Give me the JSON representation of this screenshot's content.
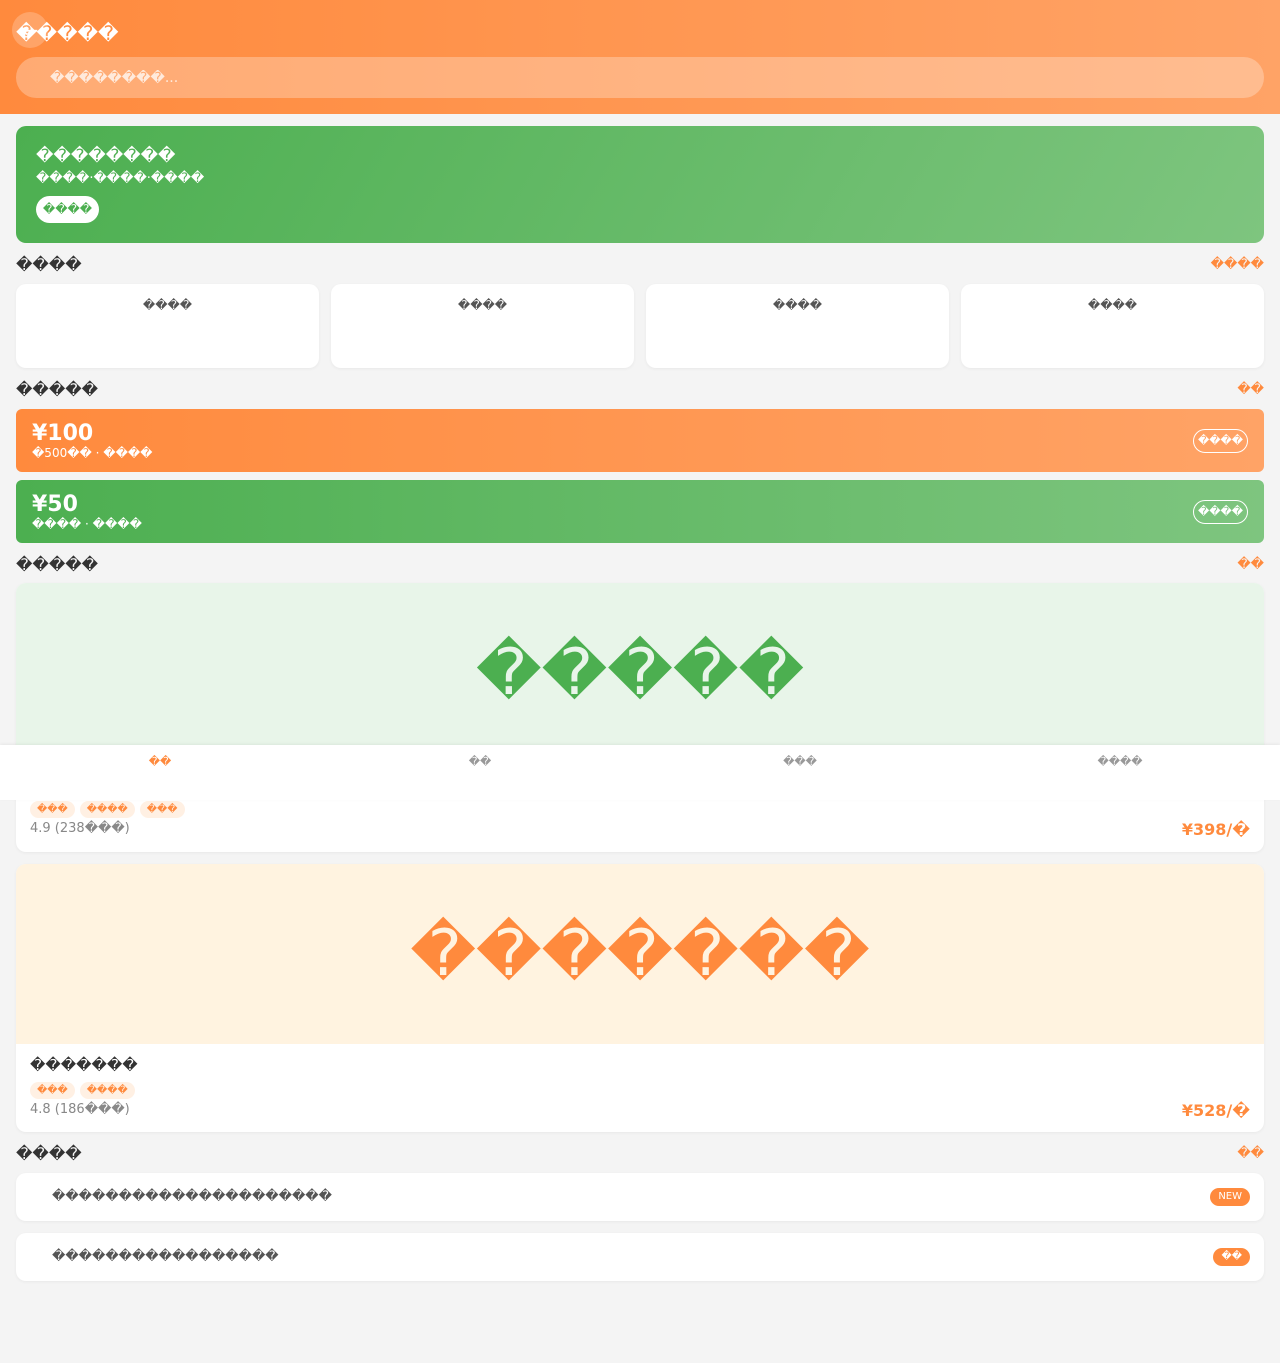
{
  "header": {
    "back_icon": "←",
    "title": "�����",
    "icons": [
      "",
      ""
    ],
    "search_icon": "",
    "search_placeholder": "��������..."
  },
  "banner": {
    "title": " ��������",
    "subtitle": "����·����·����",
    "button": "����",
    "deco_icon": ""
  },
  "services": {
    "title": "����",
    "more": "����",
    "items": [
      {
        "icon": "",
        "label": "����"
      },
      {
        "icon": "",
        "label": "����"
      },
      {
        "icon": "",
        "label": "����"
      },
      {
        "icon": "",
        "label": "����"
      }
    ]
  },
  "coupons": {
    "title": "�����",
    "more": "��",
    "items": [
      {
        "amount": "¥100",
        "desc": "�500�� · ����",
        "button": "����"
      },
      {
        "amount": "¥50",
        "desc": "���� · ����",
        "button": "����"
      }
    ]
  },
  "trips": {
    "title": " �����",
    "more": "��",
    "items": [
      {
        "image_text": " �����",
        "name": "",
        "tags": [
          " ���",
          " ����",
          " ���"
        ],
        "rating": " 4.9 (238���)",
        "price": "¥398/�"
      },
      {
        "image_text": " �������",
        "name": "�������",
        "tags": [
          " ���",
          " ����"
        ],
        "rating": " 4.8 (186���)",
        "price": "¥528/�"
      }
    ]
  },
  "notices": {
    "title": " ����",
    "more": "��",
    "items": [
      {
        "icon": "",
        "text": "���������������������",
        "badge": "NEW"
      },
      {
        "icon": "",
        "text": "�����������������",
        "badge": "��"
      }
    ]
  },
  "bottom_nav": [
    {
      "icon": "",
      "label": "��",
      "active": true
    },
    {
      "icon": "",
      "label": "��",
      "active": false
    },
    {
      "icon": "",
      "label": "���",
      "active": false
    },
    {
      "icon": "",
      "label": "����",
      "active": false
    }
  ],
  "colors": {
    "accent_orange": "#ff8a3d",
    "accent_green": "#4caf50",
    "background": "#f4f4f4"
  }
}
